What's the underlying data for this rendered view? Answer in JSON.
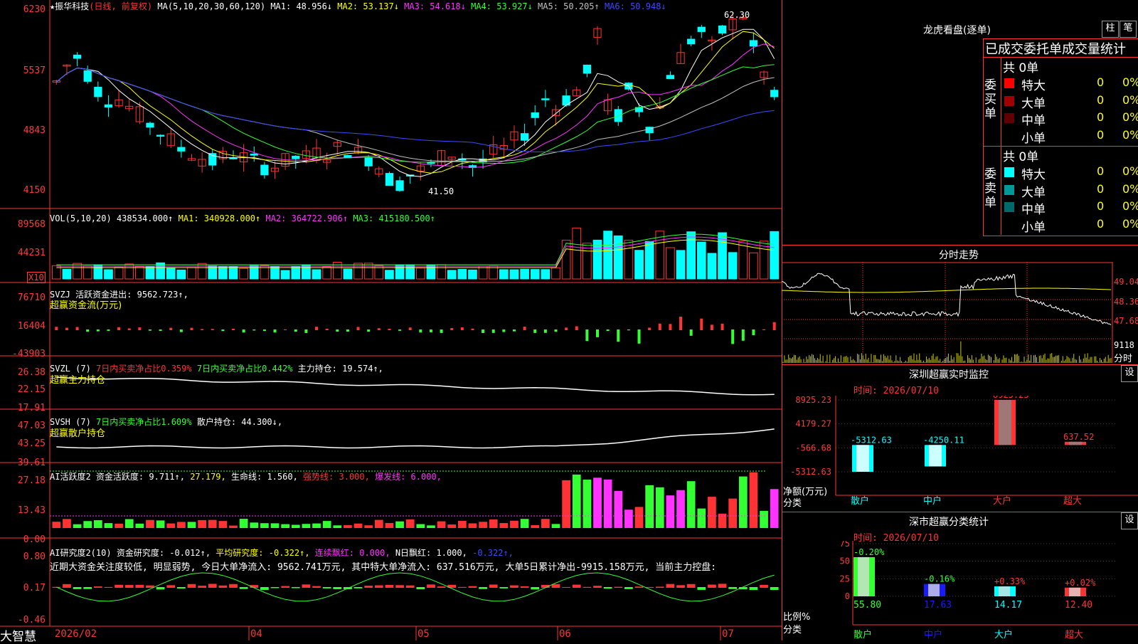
{
  "stock": {
    "name_line": "★振华科技",
    "mode": "(日线, 前复权)"
  },
  "main_ma": {
    "label": "MA(5,10,20,30,60,120)",
    "items": [
      {
        "name": "MA1:",
        "value": "48.956↓",
        "color": "#ffffff"
      },
      {
        "name": "MA2:",
        "value": "53.137↓",
        "color": "#ffff00"
      },
      {
        "name": "MA3:",
        "value": "54.618↓",
        "color": "#ff33ff"
      },
      {
        "name": "MA4:",
        "value": "53.927↓",
        "color": "#33ff33"
      },
      {
        "name": "MA5:",
        "value": "50.205↑",
        "color": "#c0c0c0"
      },
      {
        "name": "MA6:",
        "value": "50.948↓",
        "color": "#3b4bff"
      }
    ],
    "yticks": [
      "6230",
      "5537",
      "4843",
      "4150"
    ],
    "high_mark": "62.30",
    "low_mark": "41.50"
  },
  "vol": {
    "label": "VOL(5,10,20)",
    "value": "438534.000↑",
    "ma1": "MA1: 340928.000↑",
    "ma2": "MA2: 364722.906↑",
    "ma3": "MA3: 415180.500↑",
    "yticks": [
      "89568",
      "44231"
    ],
    "unit": "X10"
  },
  "svzj": {
    "label": "SVZJ",
    "desc": "活跃资金进出:",
    "value": "9562.723↑,",
    "sub": "超赢资金流(万元)",
    "yticks": [
      "76710",
      "16404",
      "-43903"
    ]
  },
  "svzl": {
    "label": "SVZL (7)",
    "p1": "7日内买卖净占比0.359%",
    "p2": "7日内买卖净占比0.442%",
    "p3": "主力持仓: 19.574↑,",
    "sub": "超赢主力持仓",
    "yticks": [
      "26.38",
      "22.15",
      "17.91"
    ]
  },
  "svsh": {
    "label": "SVSH (7)",
    "p1": "7日内买卖净占比1.609%",
    "p2": "散户持仓: 44.300↓,",
    "sub": "超赢散户持仓",
    "yticks": [
      "47.03",
      "43.25",
      "39.61"
    ]
  },
  "ai_hy": {
    "label": "AI活跃度2",
    "p1": "资金活跃度: 9.711↑,",
    "p2": "27.179,",
    "p3": "生命线: 1.560,",
    "p4": "强势线: 3.000,",
    "p5": "爆发线: 6.000,",
    "yticks": [
      "27.18",
      "13.43",
      "0.00"
    ]
  },
  "ai_yj": {
    "label": "AI研究度2(10)",
    "p1": "资金研究度: -0.012↑,",
    "p2": "平均研究度: -0.322↑,",
    "p3": "连续飘红: 0.000,",
    "p4": "N日飘红: 1.000,",
    "p5": "-0.322↑,",
    "note": "近期大资金关注度较低, 明显弱势, 今日大单净流入: 9562.741万元, 其中特大单净流入: 637.516万元, 大单5日累计净出-9915.158万元, 当前主力控盘:",
    "yticks": [
      "0.80",
      "0.17",
      "-0.46"
    ]
  },
  "xaxis": {
    "labels": [
      "2026/02",
      "04",
      "05",
      "06",
      "07"
    ],
    "brand": "大智慧"
  },
  "lhkp": {
    "title": "龙虎看盘(逐单)",
    "btn_zhu": "柱",
    "btn_bi": "笔",
    "header": "已成交委托单成交量统计",
    "buy_side": "委买单",
    "sell_side": "委卖单",
    "buy_total": "共 0单",
    "sell_total": "共 0单",
    "buy_rows": [
      {
        "label": "特大",
        "count": "0",
        "pct": "0%",
        "color": "#ff0000"
      },
      {
        "label": "大单",
        "count": "0",
        "pct": "0%",
        "color": "#a00000"
      },
      {
        "label": "中单",
        "count": "0",
        "pct": "0%",
        "color": "#600000"
      },
      {
        "label": "小单",
        "count": "0",
        "pct": "0%",
        "color": "#000000"
      }
    ],
    "sell_rows": [
      {
        "label": "特大",
        "count": "0",
        "pct": "0%",
        "color": "#00ffff"
      },
      {
        "label": "大单",
        "count": "0",
        "pct": "0%",
        "color": "#009999"
      },
      {
        "label": "中单",
        "count": "0",
        "pct": "0%",
        "color": "#006a6a"
      },
      {
        "label": "小单",
        "count": "0",
        "pct": "0%",
        "color": "#000000"
      }
    ]
  },
  "fenshi": {
    "title": "分时走势",
    "yticks": [
      "49.04",
      "48.36",
      "47.68"
    ],
    "vol_label": "9118",
    "vol_unit": "分时"
  },
  "szcy": {
    "title": "深圳超赢实时监控",
    "btn": "设",
    "time": "时间: 2026/07/10",
    "yticks": [
      "8925.23",
      "4179.27",
      "-566.68",
      "-5312.63"
    ],
    "ylabel": "净额(万元)",
    "xlabel": "分类",
    "bars": [
      {
        "cat": "散户",
        "value": "-5312.63"
      },
      {
        "cat": "中户",
        "value": "-4250.11"
      },
      {
        "cat": "大户",
        "value": "8925.23"
      },
      {
        "cat": "超大",
        "value": "637.52"
      }
    ]
  },
  "sscy": {
    "title": "深市超赢分类统计",
    "btn": "设",
    "time": "时间: 2026/07/10",
    "yticks": [
      "75",
      "50",
      "25",
      "0"
    ],
    "ylabel": "比例%",
    "xlabel": "分类",
    "bars": [
      {
        "cat": "散户",
        "value": "55.80",
        "delta": "-0.20%"
      },
      {
        "cat": "中户",
        "value": "17.63",
        "delta": "-0.16%"
      },
      {
        "cat": "大户",
        "value": "14.17",
        "delta": "+0.33%"
      },
      {
        "cat": "超大",
        "value": "12.40",
        "delta": "+0.02%"
      }
    ]
  },
  "chart_data": {
    "type": "bar",
    "title": "深圳超赢实时监控",
    "categories": [
      "散户",
      "中户",
      "大户",
      "超大"
    ],
    "series": [
      {
        "name": "净额(万元)",
        "values": [
          -5312.63,
          -4250.11,
          8925.23,
          637.52
        ]
      },
      {
        "name": "比例%",
        "values": [
          55.8,
          17.63,
          14.17,
          12.4
        ]
      }
    ]
  }
}
